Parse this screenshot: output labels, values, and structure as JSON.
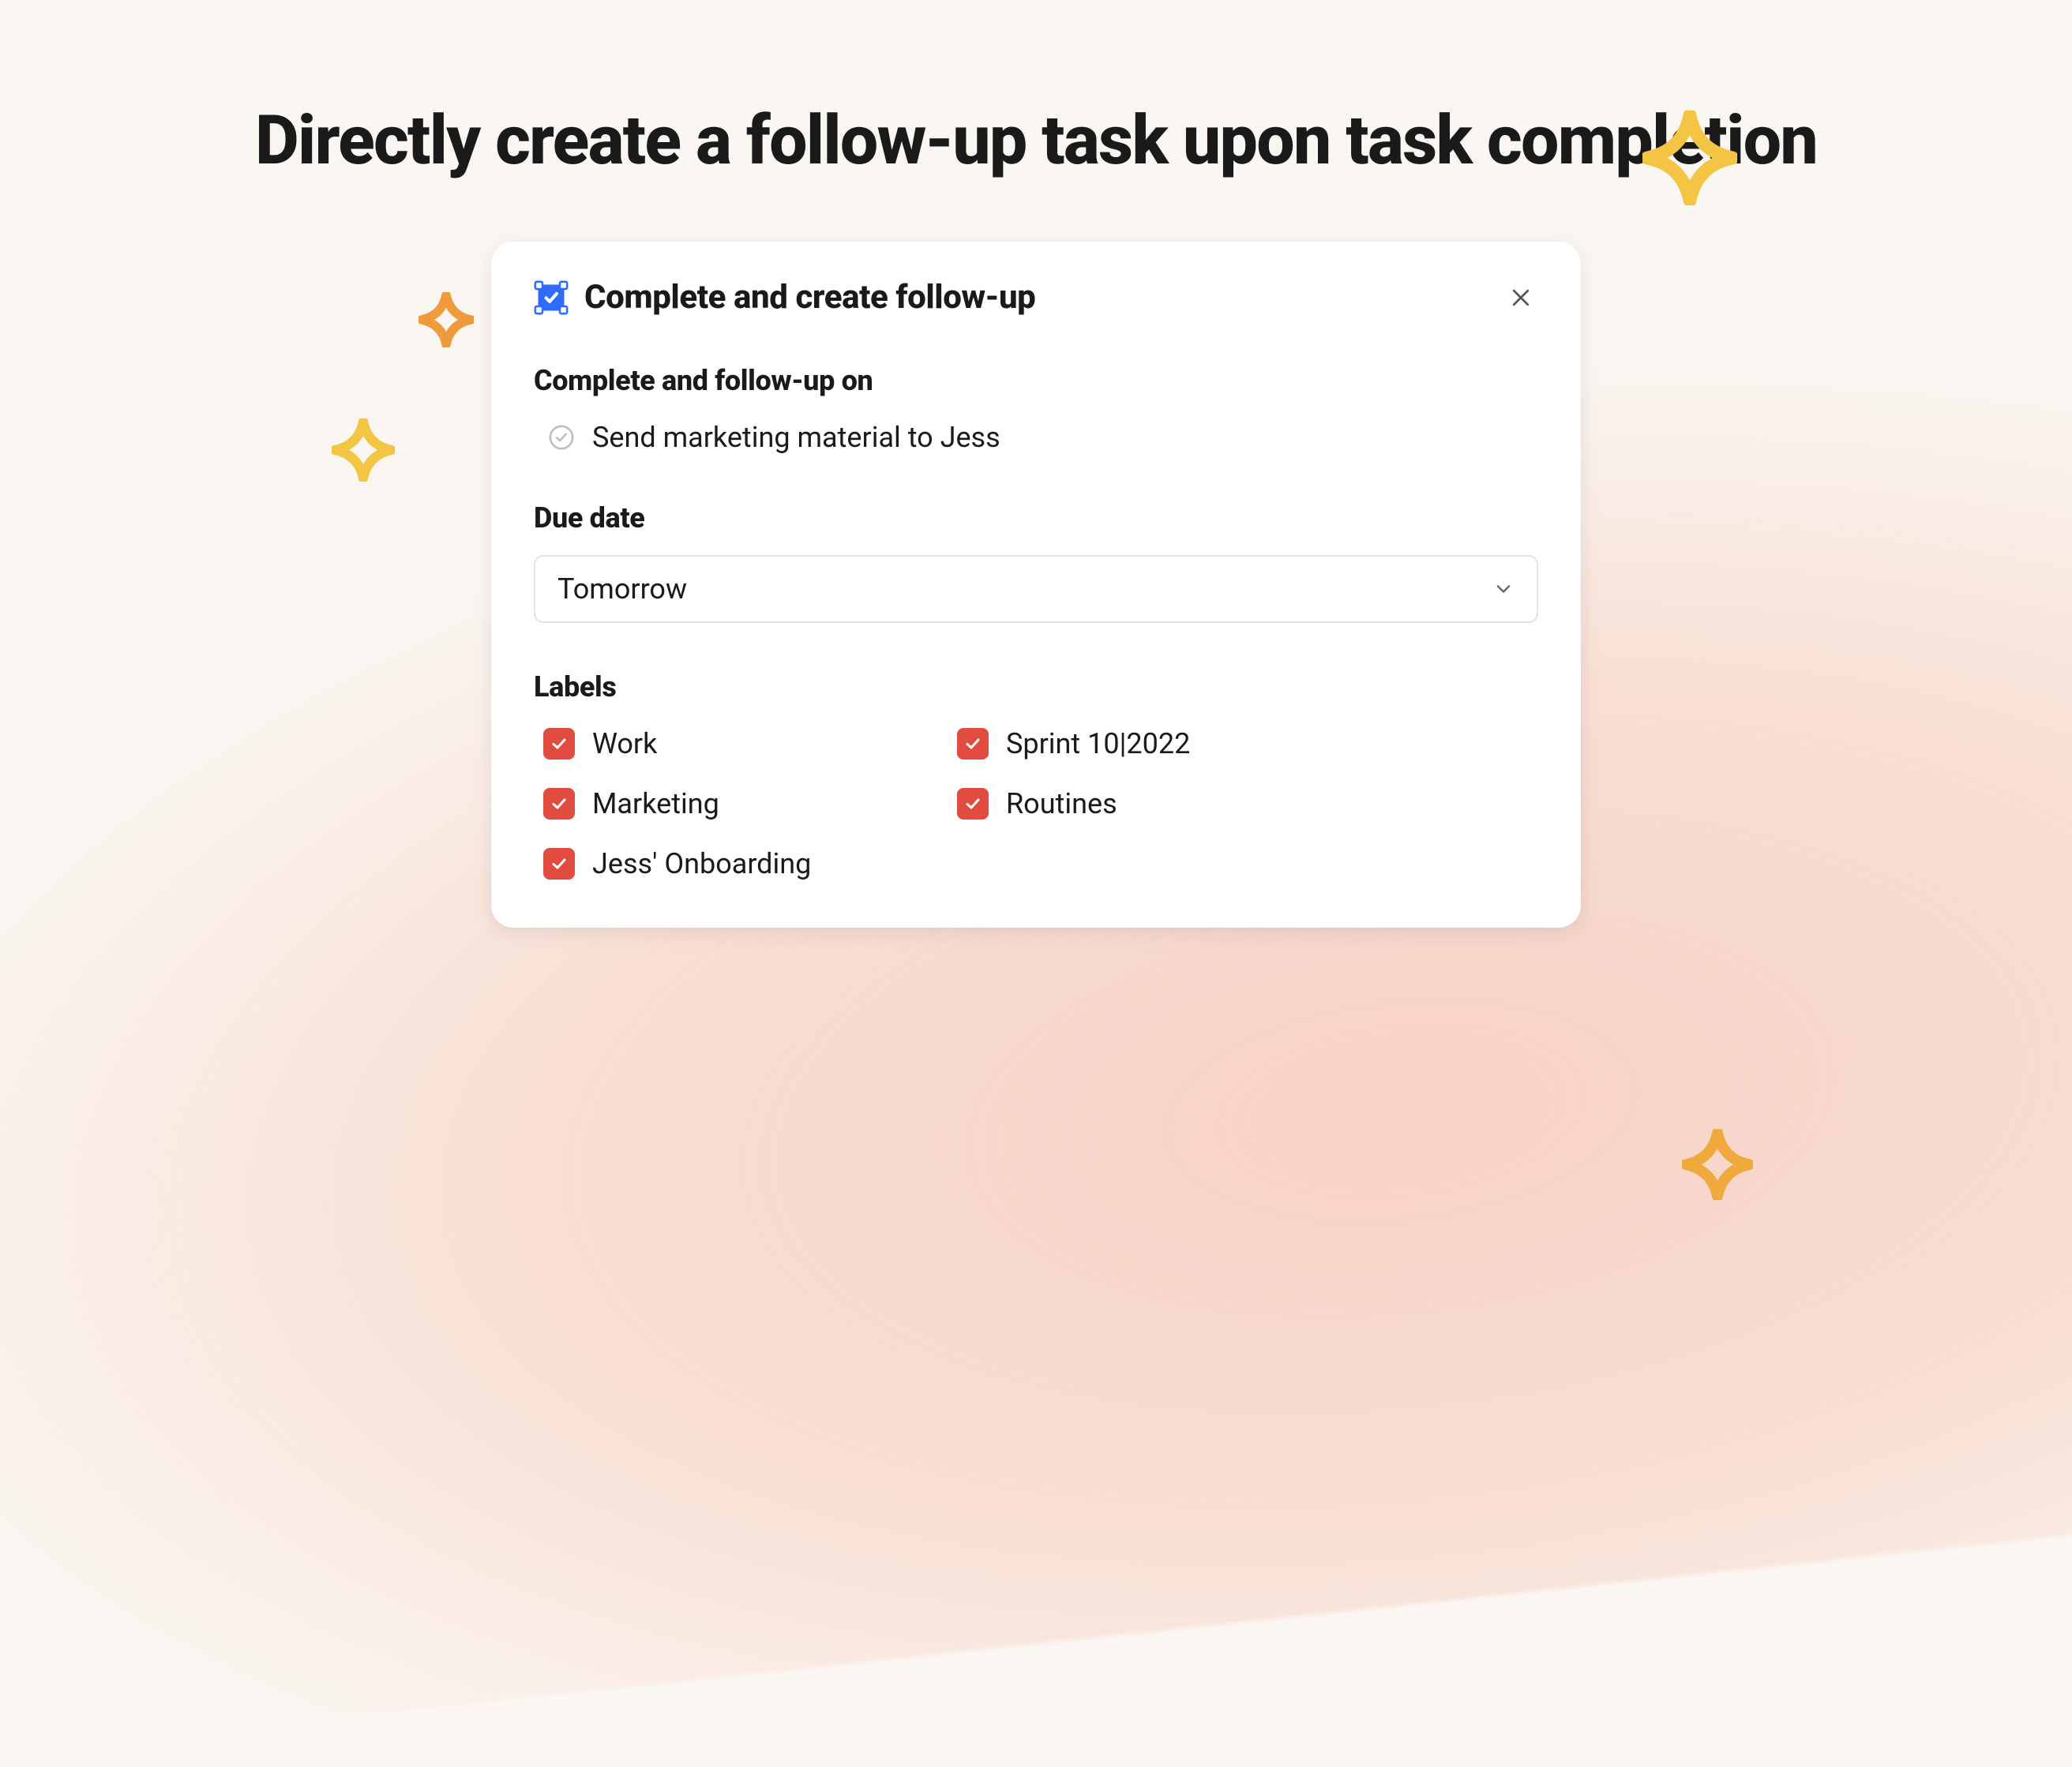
{
  "page": {
    "headline": "Directly create a follow-up task upon task completion"
  },
  "modal": {
    "title": "Complete and create follow-up",
    "sections": {
      "followup_label": "Complete and follow-up on",
      "task_name": "Send marketing material to Jess",
      "due_date_label": "Due date",
      "due_date_value": "Tomorrow",
      "labels_label": "Labels"
    },
    "labels": {
      "col1": [
        {
          "text": "Work",
          "checked": true
        },
        {
          "text": "Marketing",
          "checked": true
        },
        {
          "text": "Jess' Onboarding",
          "checked": true
        }
      ],
      "col2": [
        {
          "text": "Sprint 10|2022",
          "checked": true
        },
        {
          "text": "Routines",
          "checked": true
        }
      ]
    }
  },
  "colors": {
    "checkbox": "#e24b3f",
    "icon": "#2f6bff"
  }
}
